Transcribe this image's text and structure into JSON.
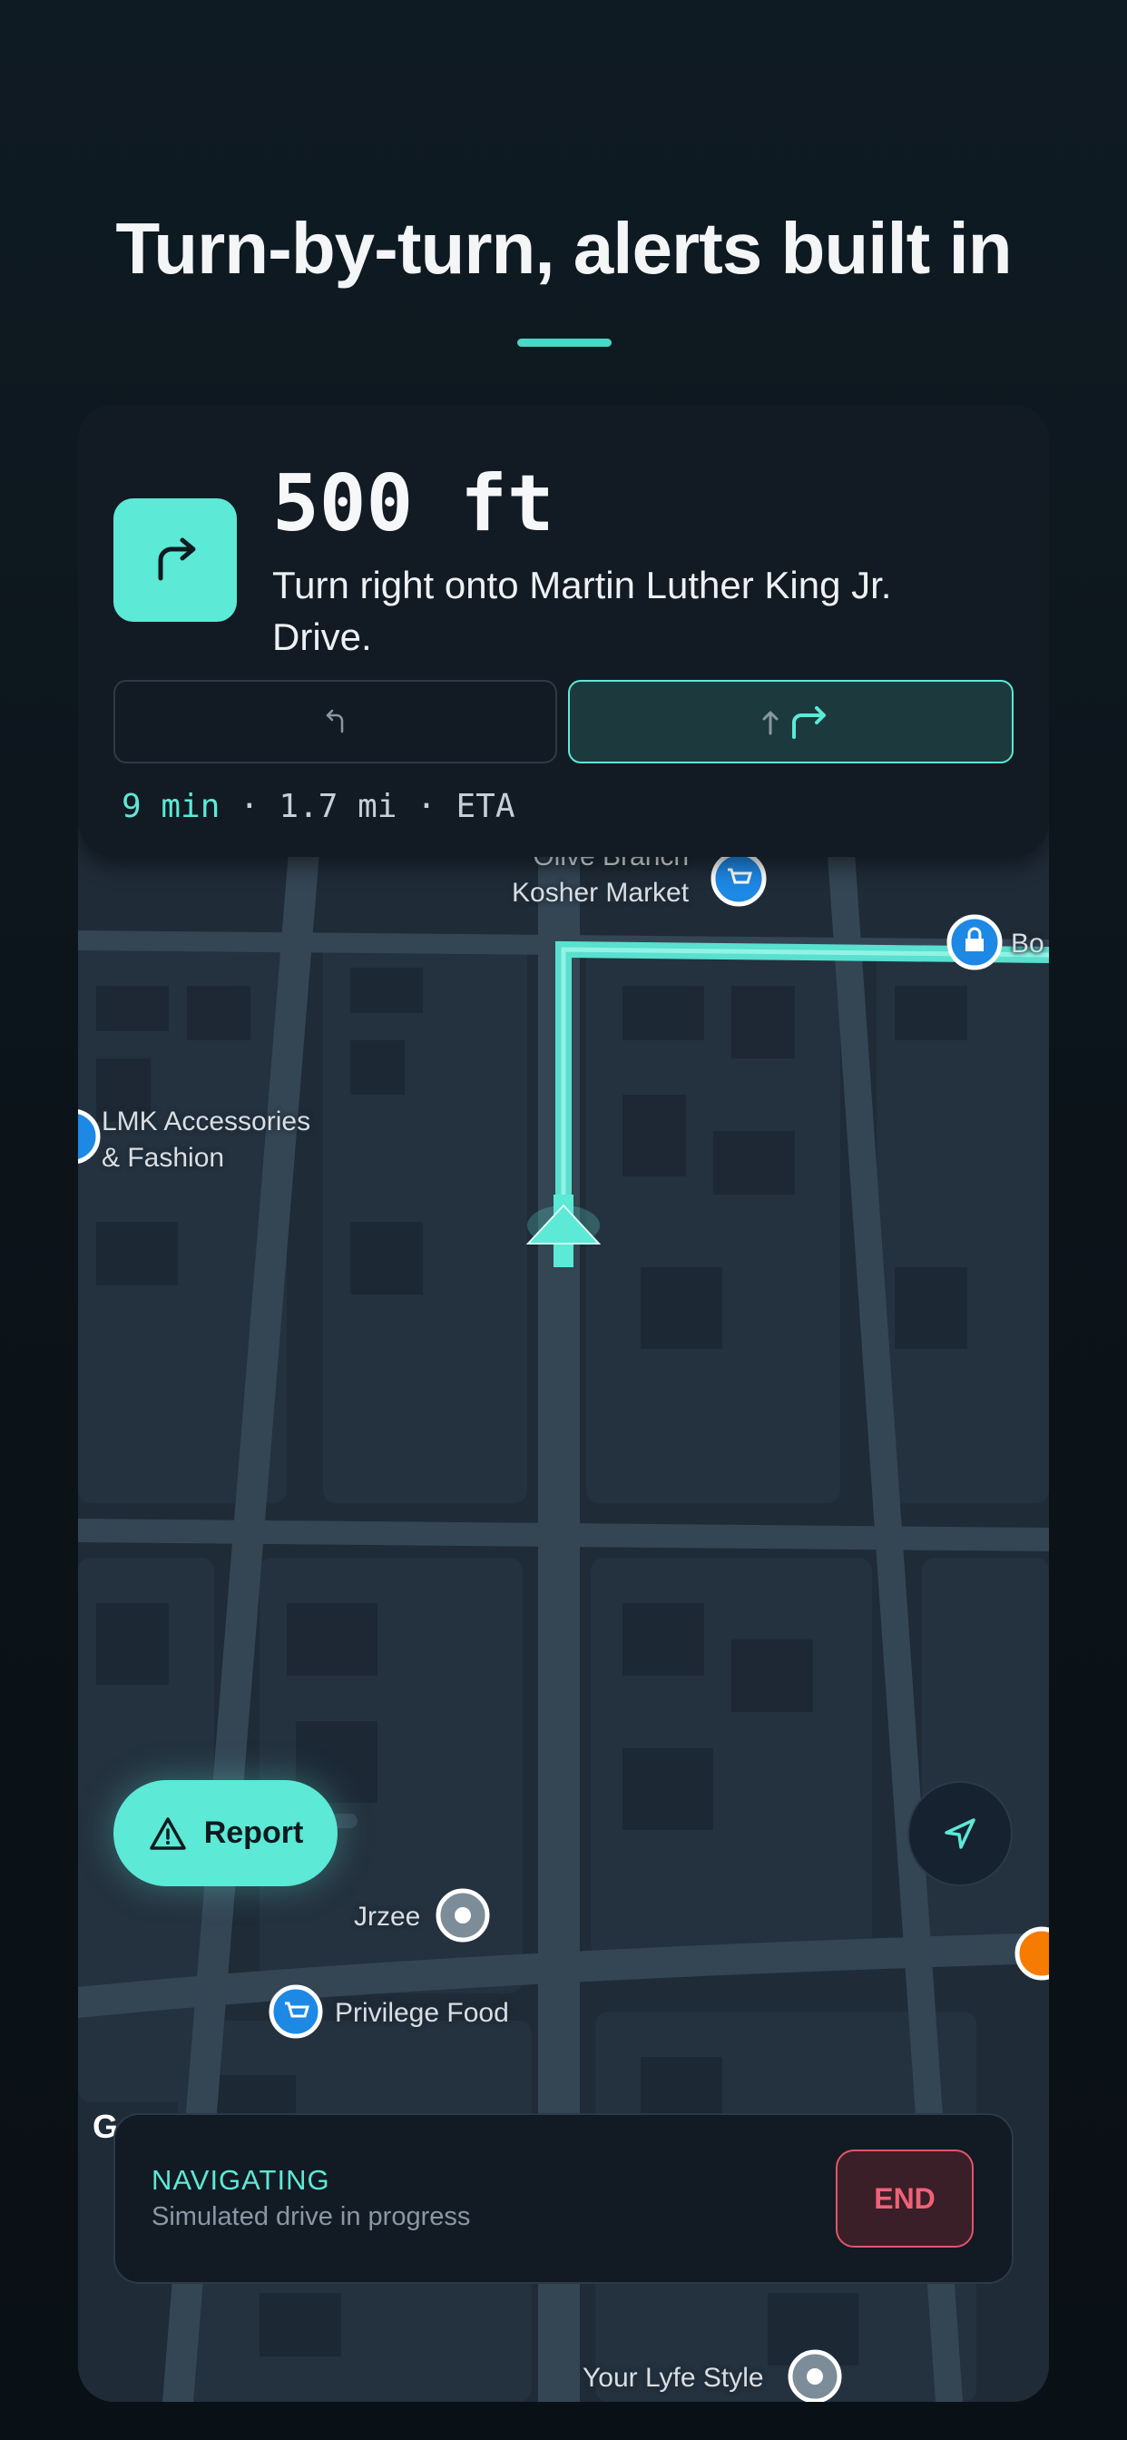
{
  "headline": "Turn-by-turn, alerts built in",
  "colors": {
    "accent": "#5ce9d6",
    "background": "#0b1218",
    "end": "#ef6277"
  },
  "nav": {
    "distance": "500 ft",
    "instruction": "Turn right onto Martin Luther King Jr. Drive.",
    "turn_icon": "turn-right-icon",
    "lanes": [
      {
        "icon": "turn-left-icon",
        "active": false
      },
      {
        "icon": "straight-or-right-icon",
        "active": true
      }
    ],
    "eta_minutes": "9 min",
    "eta_sep1": " · ",
    "eta_distance": "1.7 mi",
    "eta_sep2": " · ",
    "eta_label": "ETA"
  },
  "map": {
    "pois": [
      {
        "name": "Olive Branch\nKosher Market",
        "icon": "shopping-cart-icon"
      },
      {
        "name": "Bo",
        "icon": "shopping-bag-icon"
      },
      {
        "name": "LMK Accessories\n& Fashion",
        "icon": "place-icon"
      },
      {
        "name": "Jrzee",
        "icon": "place-icon"
      },
      {
        "name": "Privilege Food",
        "icon": "shopping-cart-icon"
      },
      {
        "name": "Your Lyfe Style",
        "icon": "place-icon"
      },
      {
        "name": "",
        "icon": "restaurant-icon"
      }
    ],
    "attribution": "G"
  },
  "report_label": "Report",
  "status": {
    "title": "NAVIGATING",
    "subtitle": "Simulated drive in progress",
    "end_label": "END"
  }
}
